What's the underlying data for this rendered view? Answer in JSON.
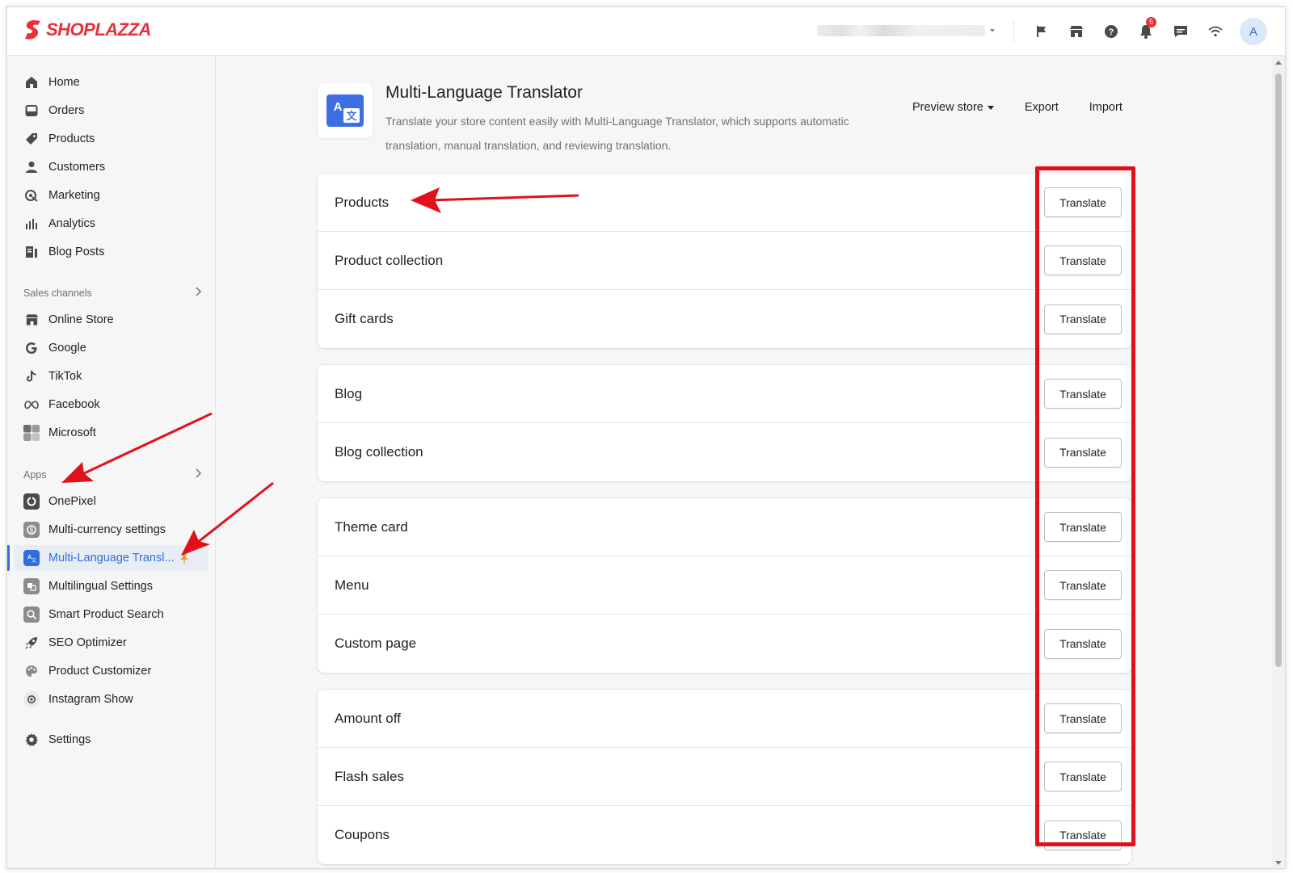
{
  "brand": {
    "name": "SHOPLAZZA",
    "color": "#e8303a"
  },
  "topbar": {
    "icons": [
      "flag-icon",
      "store-icon",
      "help-icon",
      "bell-icon",
      "chat-icon",
      "wifi-icon"
    ],
    "notification_count": "5",
    "avatar_initial": "A"
  },
  "sidebar": {
    "main_items": [
      {
        "label": "Home",
        "icon": "home-icon"
      },
      {
        "label": "Orders",
        "icon": "orders-icon"
      },
      {
        "label": "Products",
        "icon": "tag-icon"
      },
      {
        "label": "Customers",
        "icon": "person-icon"
      },
      {
        "label": "Marketing",
        "icon": "marketing-icon"
      },
      {
        "label": "Analytics",
        "icon": "bar-chart-icon"
      },
      {
        "label": "Blog Posts",
        "icon": "blog-icon"
      }
    ],
    "sales_channels_label": "Sales channels",
    "sales_channels": [
      {
        "label": "Online Store",
        "icon": "store-icon"
      },
      {
        "label": "Google",
        "icon": "google-icon"
      },
      {
        "label": "TikTok",
        "icon": "tiktok-icon"
      },
      {
        "label": "Facebook",
        "icon": "meta-icon"
      },
      {
        "label": "Microsoft",
        "icon": "microsoft-icon"
      }
    ],
    "apps_label": "Apps",
    "apps": [
      {
        "label": "OnePixel",
        "icon": "onepixel-icon"
      },
      {
        "label": "Multi-currency settings",
        "icon": "currency-icon"
      },
      {
        "label": "Multi-Language Transl...",
        "icon": "translate-icon",
        "active": true
      },
      {
        "label": "Multilingual Settings",
        "icon": "multilingual-icon"
      },
      {
        "label": "Smart Product Search",
        "icon": "search-icon"
      },
      {
        "label": "SEO Optimizer",
        "icon": "rocket-icon"
      },
      {
        "label": "Product Customizer",
        "icon": "customizer-icon"
      },
      {
        "label": "Instagram Show",
        "icon": "instagram-icon"
      }
    ],
    "settings_label": "Settings",
    "accent_color": "#2e6fe0"
  },
  "app": {
    "title": "Multi-Language Translator",
    "description": "Translate your store content easily with Multi-Language Translator, which supports automatic translation, manual translation, and reviewing translation.",
    "actions": {
      "preview": "Preview store",
      "export": "Export",
      "import": "Import"
    }
  },
  "sections": [
    {
      "rows": [
        "Products",
        "Product collection",
        "Gift cards"
      ]
    },
    {
      "rows": [
        "Blog",
        "Blog collection"
      ]
    },
    {
      "rows": [
        "Theme card",
        "Menu",
        "Custom page"
      ]
    },
    {
      "rows": [
        "Amount off",
        "Flash sales",
        "Coupons"
      ]
    }
  ],
  "button_label": "Translate",
  "annotation_color": "#e0111b"
}
